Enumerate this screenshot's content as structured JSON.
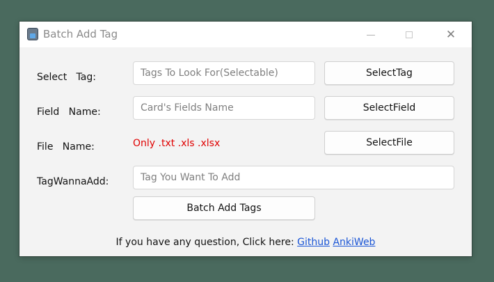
{
  "window": {
    "title": "Batch Add Tag"
  },
  "rows": {
    "select_tag": {
      "label": "Select   Tag:",
      "placeholder": "Tags To Look For(Selectable)",
      "button": "SelectTag"
    },
    "field_name": {
      "label": "Field   Name:",
      "placeholder": "Card's Fields Name",
      "button": "SelectField"
    },
    "file_name": {
      "label": "File   Name:",
      "hint": "Only .txt .xls .xlsx",
      "button": "SelectFile"
    },
    "tag_add": {
      "label": "TagWannaAdd:",
      "placeholder": "Tag You Want To Add"
    }
  },
  "batch_button": "Batch Add Tags",
  "footer": {
    "text": "If you have any question, Click here: ",
    "link1": "Github",
    "link2": "AnkiWeb"
  },
  "colors": {
    "hint": "#e00000",
    "link": "#1a55d6"
  },
  "icons": [
    "app-icon",
    "minimize-icon",
    "maximize-icon",
    "close-icon"
  ]
}
